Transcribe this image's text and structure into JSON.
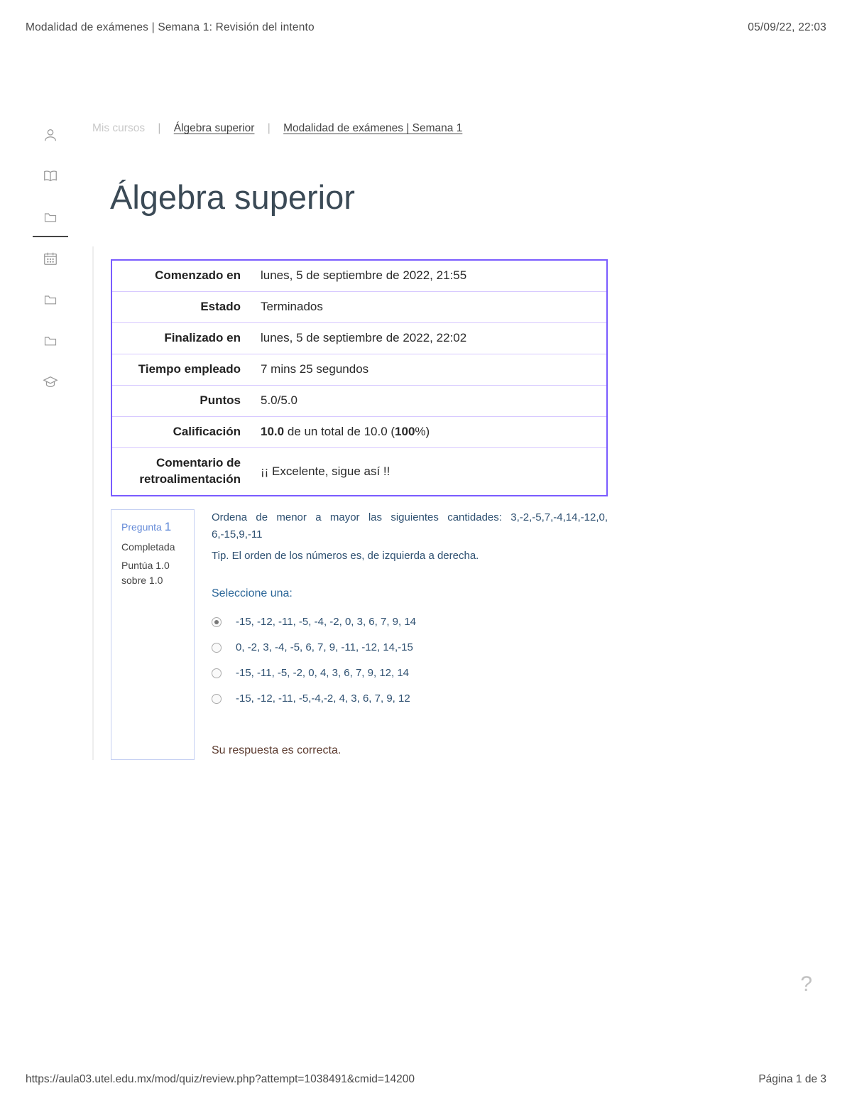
{
  "header": {
    "title": "Modalidad de exámenes | Semana 1: Revisión del intento",
    "datetime": "05/09/22, 22:03"
  },
  "footer": {
    "url": "https://aula03.utel.edu.mx/mod/quiz/review.php?attempt=1038491&cmid=14200",
    "page": "Página 1 de 3"
  },
  "breadcrumb": {
    "root": "Mis cursos",
    "course": "Álgebra superior",
    "item": "Modalidad de exámenes | Semana 1"
  },
  "page_title": "Álgebra superior",
  "summary": {
    "rows": [
      {
        "label": "Comenzado en",
        "value": "lunes, 5 de septiembre de 2022, 21:55"
      },
      {
        "label": "Estado",
        "value": "Terminados"
      },
      {
        "label": "Finalizado en",
        "value": "lunes, 5 de septiembre de 2022, 22:02"
      },
      {
        "label": "Tiempo empleado",
        "value": "7 mins 25 segundos"
      },
      {
        "label": "Puntos",
        "value": "5.0/5.0"
      },
      {
        "label": "Calificación",
        "value_pre": "",
        "bold1": "10.0",
        "mid": " de un total de 10.0 (",
        "bold2": "100",
        "post": "%)"
      },
      {
        "label": "Comentario de retroalimentación",
        "value": "¡¡ Excelente, sigue así !!"
      }
    ]
  },
  "question": {
    "label": "Pregunta",
    "number": "1",
    "status": "Completada",
    "grade_text": "Puntúa 1.0 sobre 1.0",
    "prompt": "Ordena de menor a mayor las siguientes cantidades: 3,-2,-5,7,-4,14,-12,0, 6,-15,9,-11",
    "tip": "Tip. El orden de los números es, de izquierda a derecha.",
    "select_label": "Seleccione una:",
    "options": [
      {
        "text": "-15, -12, -11, -5, -4, -2, 0, 3, 6, 7, 9, 14",
        "selected": true
      },
      {
        "text": "0, -2, 3, -4, -5, 6, 7, 9, -11, -12, 14,-15",
        "selected": false
      },
      {
        "text": "-15, -11, -5, -2, 0, 4, 3, 6, 7, 9, 12, 14",
        "selected": false
      },
      {
        "text": "-15, -12, -11, -5,-4,-2, 4, 3, 6, 7, 9, 12",
        "selected": false
      }
    ],
    "feedback": "Su respuesta es correcta."
  },
  "help_icon": "?"
}
